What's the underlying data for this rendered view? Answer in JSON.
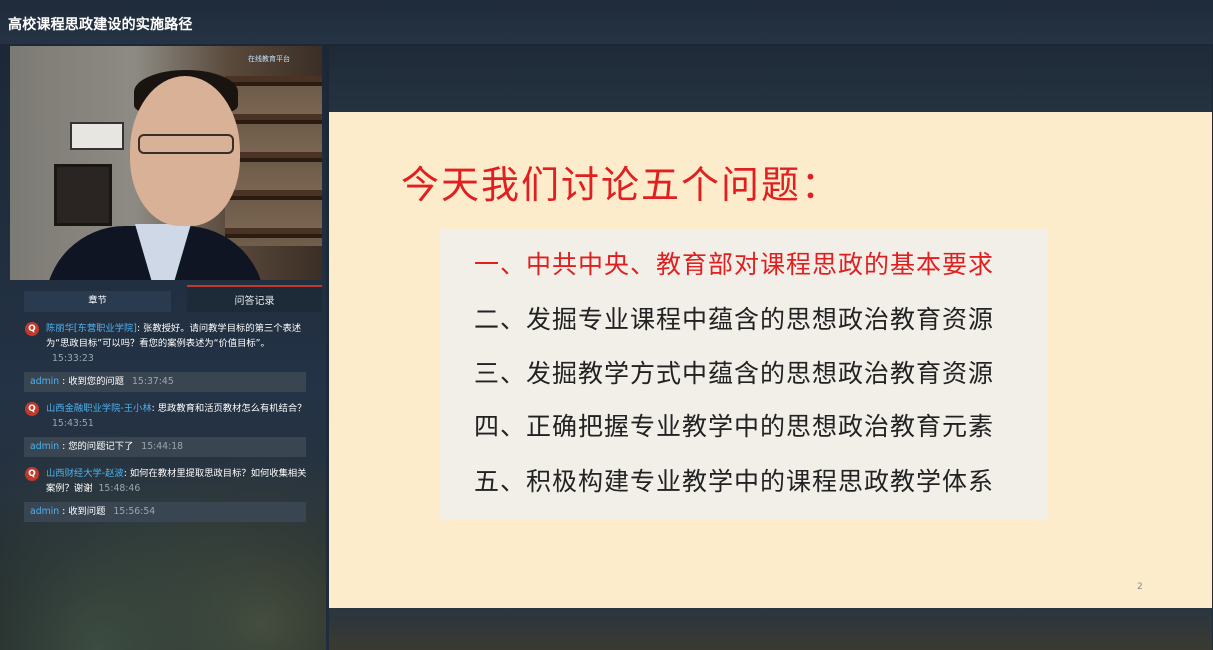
{
  "window": {
    "title": "高校课程思政建设的实施路径"
  },
  "video": {
    "logo_text": "在线教育平台"
  },
  "tabs": [
    {
      "label": "章节"
    },
    {
      "label": "问答记录"
    }
  ],
  "qa": [
    {
      "name": "陈丽华[东营职业学院]",
      "text": "张教授好。请问教学目标的第三个表述为“思政目标”可以吗？看您的案例表述为“价值目标”。",
      "time": "15:33:23",
      "answer": {
        "name": "admin",
        "text": "收到您的问题",
        "time": "15:37:45"
      }
    },
    {
      "name": "山西金融职业学院-王小林",
      "text": "思政教育和活页教材怎么有机结合？",
      "time": "15:43:51",
      "answer": {
        "name": "admin",
        "text": "您的问题记下了",
        "time": "15:44:18"
      }
    },
    {
      "name": "山西财经大学-赵波",
      "text": "如何在教材里提取思政目标？如何收集相关案例？谢谢",
      "time": "15:48:46",
      "answer": {
        "name": "admin",
        "text": "收到问题",
        "time": "15:56:54"
      }
    }
  ],
  "slide": {
    "title": "今天我们讨论五个问题：",
    "items": [
      "一、中共中央、教育部对课程思政的基本要求",
      "二、发掘专业课程中蕴含的思想政治教育资源",
      "三、发掘教学方式中蕴含的思想政治教育资源",
      "四、正确把握专业教学中的思想政治教育元素",
      "五、积极构建专业教学中的课程思政教学体系"
    ],
    "page_number": "2"
  },
  "colors": {
    "accent_red": "#e02020",
    "slide_bg": "#fdeccb",
    "link_blue": "#4fb2f0"
  }
}
